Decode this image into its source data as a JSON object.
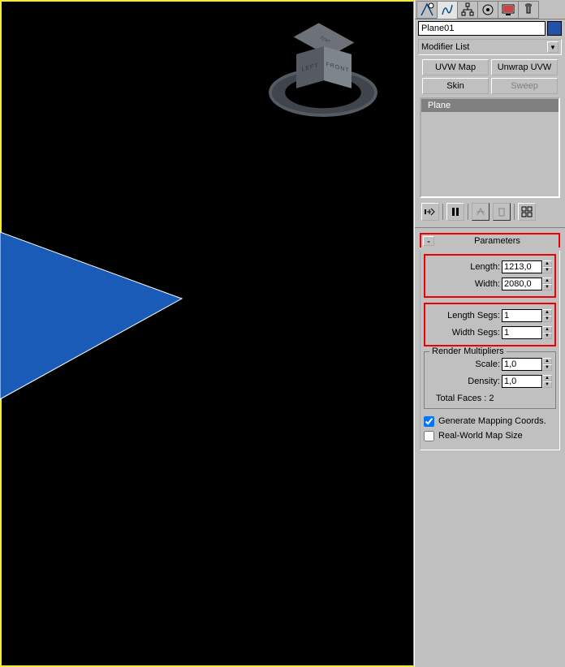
{
  "viewport": {
    "cube_top": "TOP",
    "cube_left": "LEFT",
    "cube_front": "FRONT"
  },
  "panel": {
    "object_name": "Plane01",
    "modifier_combo": "Modifier List",
    "buttons": {
      "uvw_map": "UVW Map",
      "unwrap_uvw": "Unwrap UVW",
      "skin": "Skin",
      "sweep": "Sweep"
    },
    "stack_item": "Plane"
  },
  "parameters": {
    "title": "Parameters",
    "length_lbl": "Length:",
    "length_val": "1213,0",
    "width_lbl": "Width:",
    "width_val": "2080,0",
    "lenseg_lbl": "Length Segs:",
    "lenseg_val": "1",
    "widseg_lbl": "Width Segs:",
    "widseg_val": "1",
    "render_title": "Render Multipliers",
    "scale_lbl": "Scale:",
    "scale_val": "1,0",
    "density_lbl": "Density:",
    "density_val": "1,0",
    "total_faces": "Total Faces : 2",
    "gen_mapping": "Generate Mapping Coords.",
    "real_world": "Real-World Map Size"
  }
}
